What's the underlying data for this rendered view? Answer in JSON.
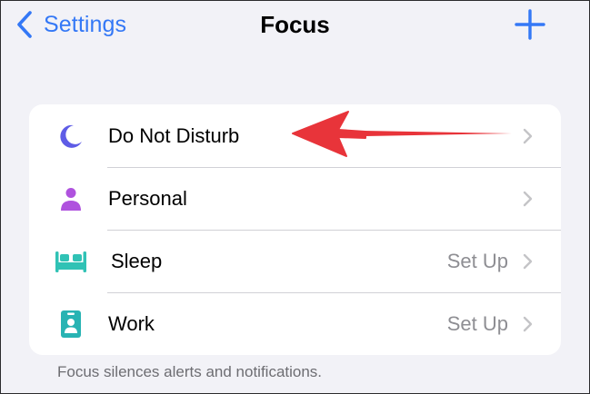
{
  "nav": {
    "back_label": "Settings",
    "title": "Focus",
    "add_icon": "plus-icon"
  },
  "colors": {
    "accent": "#3478f6",
    "dnd": "#5e5ce6",
    "personal": "#af52de",
    "sleep": "#30c2b5",
    "work": "#28b3b3",
    "annotation": "#e8343a"
  },
  "focus_list": {
    "items": [
      {
        "label": "Do Not Disturb",
        "detail": "",
        "icon": "moon-icon"
      },
      {
        "label": "Personal",
        "detail": "",
        "icon": "person-icon"
      },
      {
        "label": "Sleep",
        "detail": "Set Up",
        "icon": "bed-icon"
      },
      {
        "label": "Work",
        "detail": "Set Up",
        "icon": "id-badge-icon"
      }
    ],
    "footer": "Focus silences alerts and notifications."
  }
}
